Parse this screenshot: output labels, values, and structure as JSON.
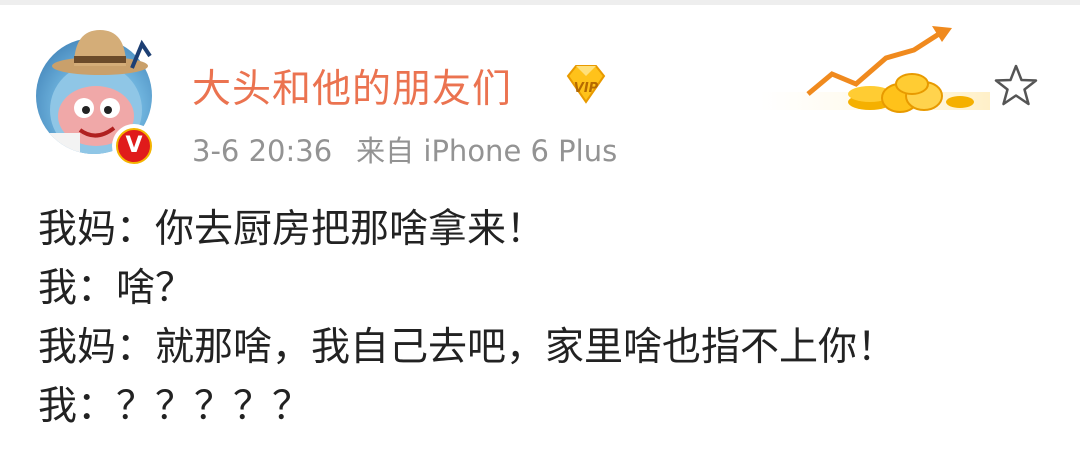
{
  "post": {
    "username": "大头和他的朋友们",
    "vip_label": "VIP",
    "timestamp": "3-6 20:36",
    "source": "来自 iPhone 6 Plus",
    "verified_label": "V",
    "lines": [
      "我妈：你去厨房把那啥拿来！",
      "我：啥？",
      "我妈：就那啥，我自己去吧，家里啥也指不上你！",
      "我：？？？？？"
    ]
  },
  "icons": {
    "avatar": "cartoon-avatar-icon",
    "verified": "verified-v-badge-icon",
    "vip": "vip-crown-icon",
    "banner": "gold-coins-rising-arrow-icon",
    "star": "star-outline-icon"
  },
  "colors": {
    "username": "#eb7350",
    "meta": "#939393",
    "text": "#222222",
    "verified": "#e01b1b",
    "gold": "#f5b000"
  }
}
